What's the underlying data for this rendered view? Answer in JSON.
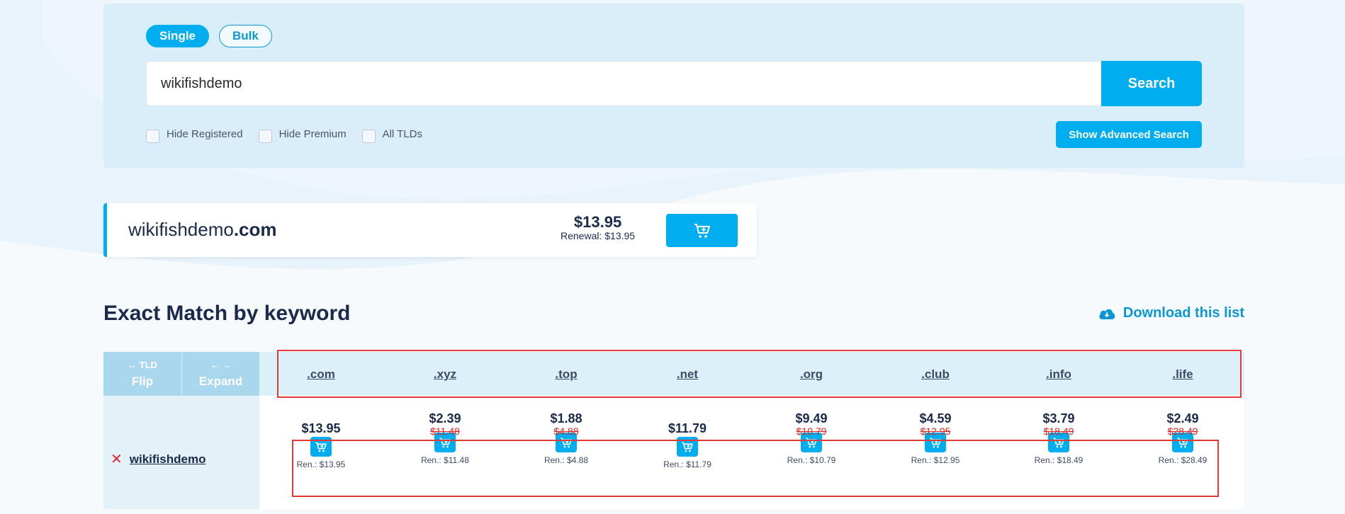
{
  "search": {
    "modes": [
      "Single",
      "Bulk"
    ],
    "active_mode": "Single",
    "query": "wikifishdemo",
    "button": "Search",
    "filters": [
      "Hide Registered",
      "Hide Premium",
      "All TLDs"
    ],
    "advanced": "Show Advanced Search"
  },
  "featured": {
    "name": "wikifishdemo",
    "tld": ".com",
    "price": "$13.95",
    "renewal": "Renewal: $13.95"
  },
  "section": {
    "title": "Exact Match by keyword",
    "download": "Download this list"
  },
  "table": {
    "flip": {
      "top": "↔ TLD",
      "bottom": "Flip"
    },
    "expand": {
      "top": "← →",
      "bottom": "Expand"
    },
    "row_domain": "wikifishdemo",
    "columns": [
      {
        "tld": ".com",
        "price": "$13.95",
        "old": "",
        "ren": "Ren.: $13.95"
      },
      {
        "tld": ".xyz",
        "price": "$2.39",
        "old": "$11.48",
        "ren": "Ren.: $11.48"
      },
      {
        "tld": ".top",
        "price": "$1.88",
        "old": "$4.88",
        "ren": "Ren.: $4.88"
      },
      {
        "tld": ".net",
        "price": "$11.79",
        "old": "",
        "ren": "Ren.: $11.79"
      },
      {
        "tld": ".org",
        "price": "$9.49",
        "old": "$10.79",
        "ren": "Ren.: $10.79"
      },
      {
        "tld": ".club",
        "price": "$4.59",
        "old": "$12.95",
        "ren": "Ren.: $12.95"
      },
      {
        "tld": ".info",
        "price": "$3.79",
        "old": "$18.49",
        "ren": "Ren.: $18.49"
      },
      {
        "tld": ".life",
        "price": "$2.49",
        "old": "$28.49",
        "ren": "Ren.: $28.49"
      }
    ]
  },
  "colors": {
    "accent": "#00aeef",
    "highlight_box": "#e53935",
    "strike": "#e02424"
  }
}
